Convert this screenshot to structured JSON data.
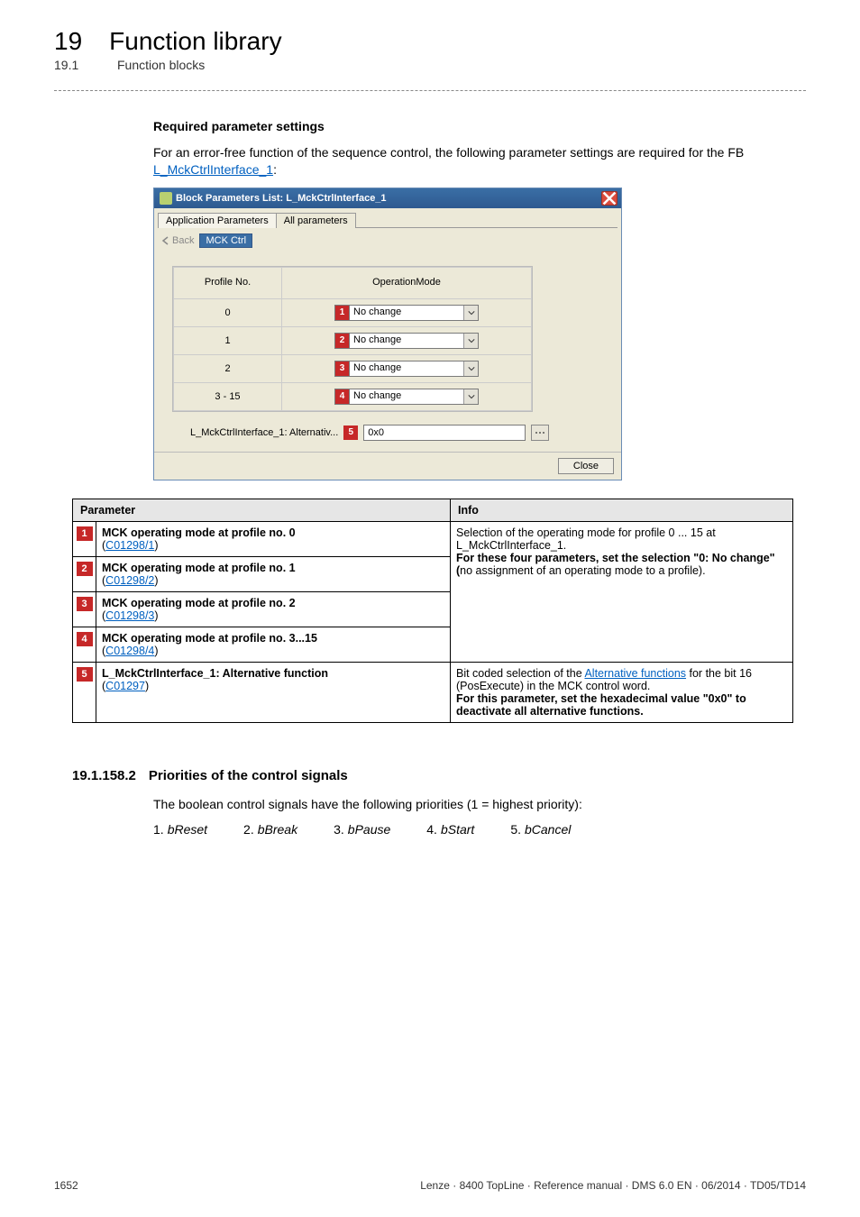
{
  "header": {
    "chapter_number": "19",
    "chapter_title": "Function library",
    "section_number": "19.1",
    "section_title": "Function blocks"
  },
  "intro": {
    "heading": "Required parameter settings",
    "text_pre": "For an error-free function of the sequence control, the following parameter settings are required for the FB ",
    "link": "L_MckCtrlInterface_1",
    "text_post": ":"
  },
  "dialog": {
    "title": "Block Parameters List: L_MckCtrlInterface_1",
    "tabs": {
      "active": "Application Parameters",
      "other": "All parameters"
    },
    "back_label": "Back",
    "breadcrumb": "MCK Ctrl",
    "columns": {
      "c1": "Profile No.",
      "c2": "OperationMode"
    },
    "rows": [
      {
        "pn": "0",
        "badge": "1",
        "mode": "No change"
      },
      {
        "pn": "1",
        "badge": "2",
        "mode": "No change"
      },
      {
        "pn": "2",
        "badge": "3",
        "mode": "No change"
      },
      {
        "pn": "3 - 15",
        "badge": "4",
        "mode": "No change"
      }
    ],
    "alt_label": "L_MckCtrlInterface_1: Alternativ...",
    "alt_badge": "5",
    "alt_value": "0x0",
    "close": "Close"
  },
  "param_table": {
    "head": {
      "p": "Parameter",
      "i": "Info"
    },
    "rows": [
      {
        "n": "1",
        "title": "MCK operating mode at profile no. 0",
        "code": "C01298/1"
      },
      {
        "n": "2",
        "title": "MCK operating mode at profile no. 1",
        "code": "C01298/2"
      },
      {
        "n": "3",
        "title": "MCK operating mode at profile no. 2",
        "code": "C01298/3"
      },
      {
        "n": "4",
        "title": "MCK operating mode at profile no. 3...15",
        "code": "C01298/4"
      },
      {
        "n": "5",
        "title": "L_MckCtrlInterface_1: Alternative function",
        "code": "C01297"
      }
    ],
    "info_group1_line1": "Selection of the operating mode for profile 0 ... 15 at L_MckCtrlInterface_1.",
    "info_group1_line2": "For these four parameters, set the selection \"0: No change\" (",
    "info_group1_line2b": "no assignment of an operating mode to a profile).",
    "info_row5_line1a": "Bit coded selection of the ",
    "info_row5_link": "Alternative functions",
    "info_row5_line1b": " for the bit 16 (PosExecute) in the MCK control word.",
    "info_row5_line2": "For this parameter, set the hexadecimal value \"0x0\" to deactivate all alternative functions."
  },
  "subsection": {
    "number": "19.1.158.2",
    "title": "Priorities of the control signals",
    "para": "The boolean control signals have the following priorities (1 = highest priority):",
    "items": [
      {
        "n": "1.",
        "v": "bReset"
      },
      {
        "n": "2.",
        "v": "bBreak"
      },
      {
        "n": "3.",
        "v": "bPause"
      },
      {
        "n": "4.",
        "v": "bStart"
      },
      {
        "n": "5.",
        "v": "bCancel"
      }
    ]
  },
  "footer": {
    "page": "1652",
    "right": "Lenze · 8400 TopLine · Reference manual · DMS 6.0 EN · 06/2014 · TD05/TD14"
  }
}
